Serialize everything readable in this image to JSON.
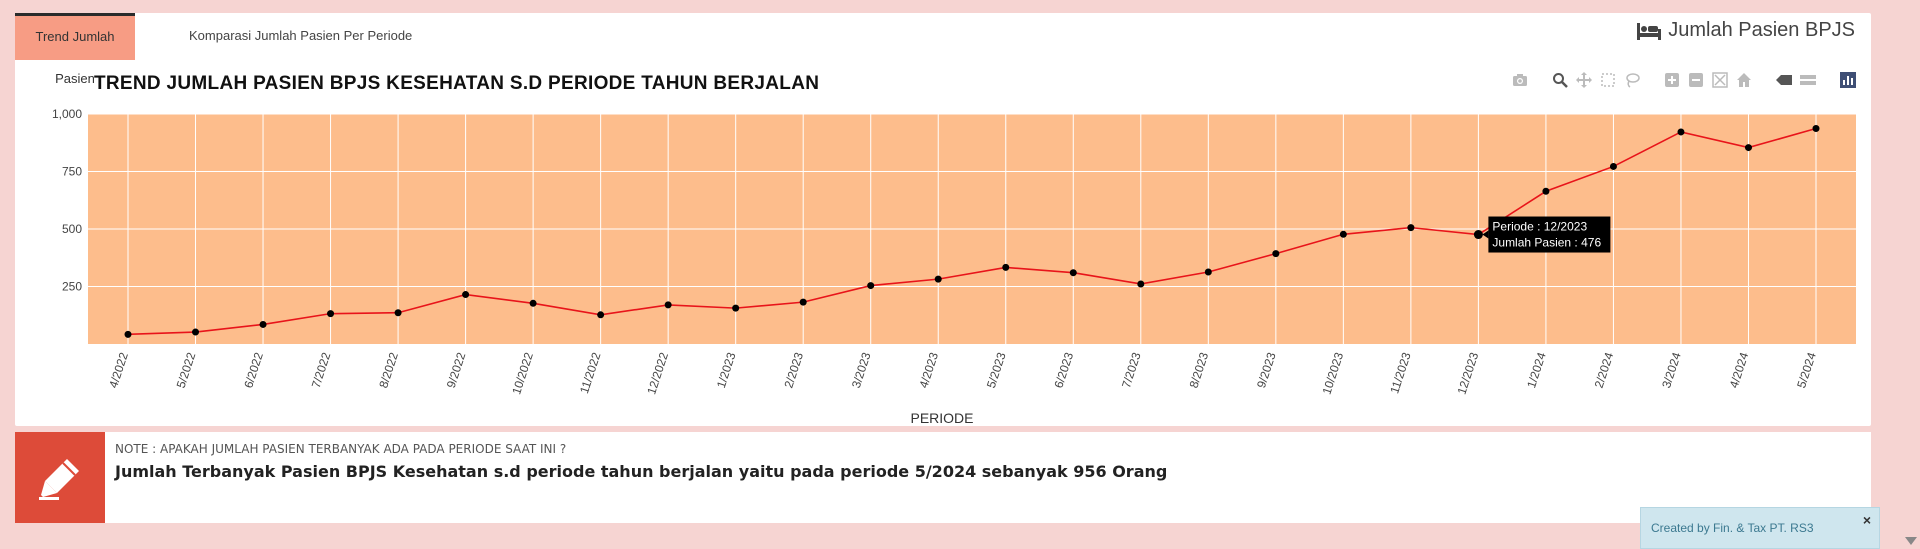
{
  "tabs": [
    {
      "label": "Trend Jumlah Pasien",
      "active": true
    },
    {
      "label": "Komparasi Jumlah Pasien Per Periode",
      "active": false
    }
  ],
  "box_title": "Jumlah Pasien BPJS",
  "box_icon": "bed-icon",
  "colors": {
    "plot_bg": "#fdbd8c",
    "line": "#e8141a",
    "marker": "#000000",
    "tab_active": "#f79c84",
    "note_icon_bg": "#dd4b39"
  },
  "chart_data": {
    "type": "line",
    "title": "TREND JUMLAH PASIEN BPJS KESEHATAN S.D PERIODE TAHUN BERJALAN",
    "xlabel": "PERIODE",
    "ylabel": "",
    "categories": [
      "4/2022",
      "5/2022",
      "6/2022",
      "7/2022",
      "8/2022",
      "9/2022",
      "10/2022",
      "11/2022",
      "12/2022",
      "1/2023",
      "2/2023",
      "3/2023",
      "4/2023",
      "5/2023",
      "6/2023",
      "7/2023",
      "8/2023",
      "9/2023",
      "10/2023",
      "11/2023",
      "12/2023",
      "1/2024",
      "2/2024",
      "3/2024",
      "4/2024",
      "5/2024"
    ],
    "series": [
      {
        "values": [
          42,
          52,
          85,
          132,
          136,
          215,
          177,
          127,
          170,
          156,
          182,
          254,
          282,
          333,
          310,
          261,
          313,
          393,
          477,
          506,
          476,
          664,
          772,
          922,
          854,
          937
        ]
      }
    ],
    "yticks": [
      250,
      500,
      750,
      1000
    ],
    "yticklabels": [
      "250",
      "500",
      "750",
      "1,000"
    ],
    "ylim": [
      0,
      1000
    ],
    "grid": true,
    "tooltip": {
      "index": 20,
      "line1": "Periode : 12/2023",
      "line2": "Jumlah Pasien : 476"
    }
  },
  "note": {
    "label": "NOTE : APAKAH JUMLAH PASIEN TERBANYAK ADA PADA PERIODE SAAT INI ?",
    "text": "Jumlah Terbanyak Pasien BPJS Kesehatan s.d periode tahun berjalan yaitu pada periode 5/2024 sebanyak 956 Orang",
    "icon": "pencil-icon"
  },
  "toast": {
    "text": "Created by Fin. & Tax PT. RS3",
    "close": "×"
  }
}
